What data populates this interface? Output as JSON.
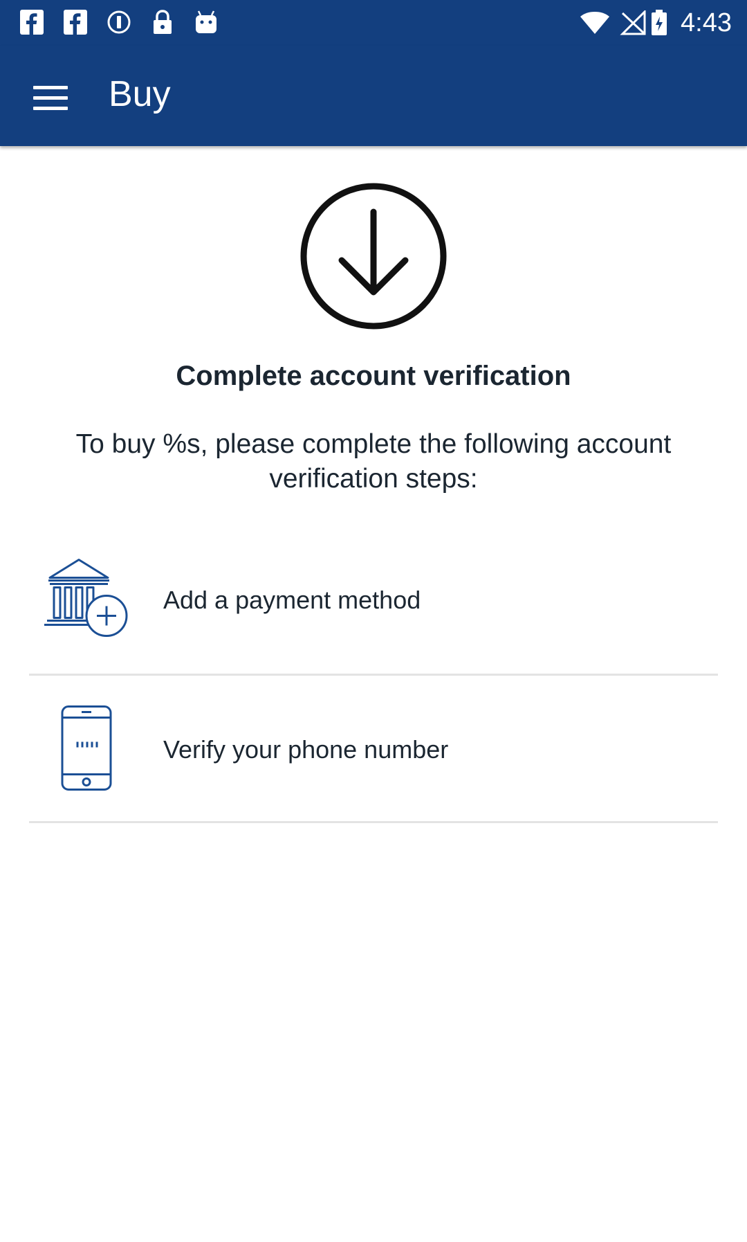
{
  "status_bar": {
    "time": "4:43",
    "left_icons": [
      "facebook-icon",
      "facebook-icon",
      "circle-info-icon",
      "lock-icon",
      "android-icon"
    ],
    "right_icons": [
      "wifi-icon",
      "no-signal-icon",
      "battery-icon"
    ]
  },
  "app_bar": {
    "title": "Buy",
    "menu_icon": "hamburger-menu-icon",
    "background_color": "#133f7f"
  },
  "main": {
    "hero_icon": "download-arrow-circle-icon",
    "heading": "Complete account verification",
    "description": "To buy %s, please complete the following account verification steps:",
    "steps": [
      {
        "label": "Add a payment method",
        "icon": "bank-add-icon"
      },
      {
        "label": "Verify your phone number",
        "icon": "smartphone-icon"
      }
    ]
  },
  "colors": {
    "brand": "#133f7f",
    "icon_blue": "#1b4f95",
    "text_dark": "#1b2631",
    "divider": "#e3e3e3"
  }
}
